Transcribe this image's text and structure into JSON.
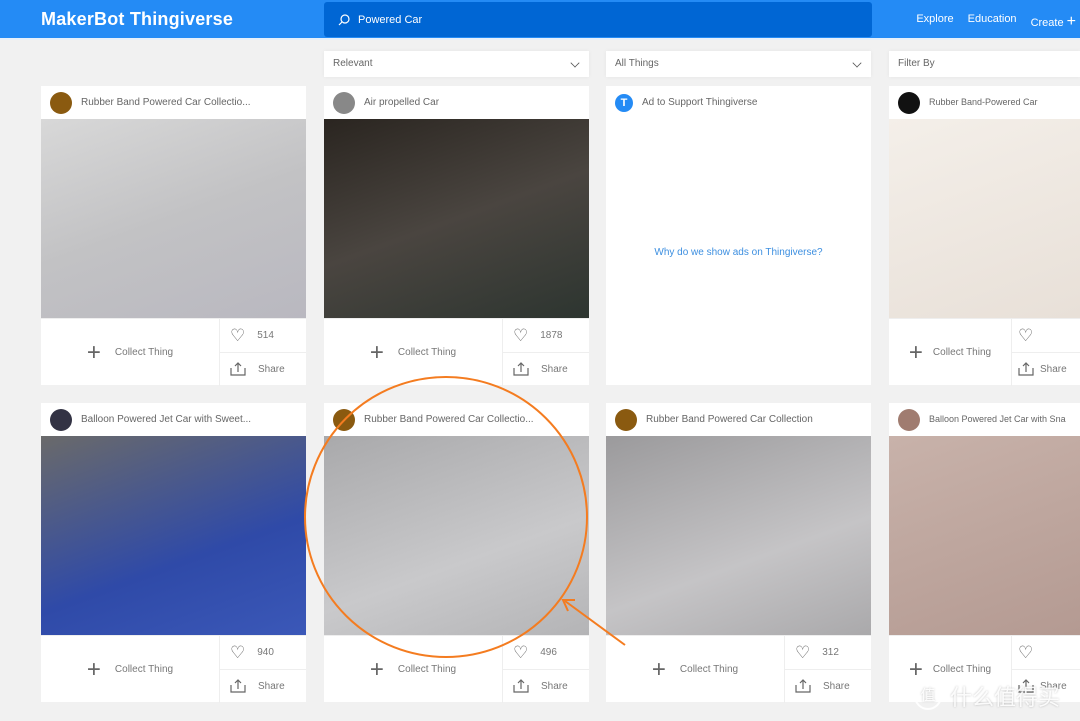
{
  "header": {
    "logo": "MakerBot Thingiverse",
    "search_value": "Powered Car",
    "nav": [
      "Explore",
      "Education",
      "Create"
    ]
  },
  "filters": {
    "sort": "Relevant",
    "type": "All Things",
    "filter": "Filter By"
  },
  "ad": {
    "title": "Ad to Support Thingiverse",
    "link": "Why do we show ads on Thingiverse?"
  },
  "collect_label": "Collect Thing",
  "share_label": "Share",
  "cards": [
    {
      "title": "Rubber Band Powered Car Collectio...",
      "likes": "514"
    },
    {
      "title": "Air propelled Car",
      "likes": "1878"
    },
    {
      "title": "Rubber Band-Powered Car",
      "likes": ""
    },
    {
      "title": "Balloon Powered Jet Car with Sweet...",
      "likes": "940"
    },
    {
      "title": "Rubber Band Powered Car Collectio...",
      "likes": "496"
    },
    {
      "title": "Rubber Band Powered Car Collection",
      "likes": "312"
    },
    {
      "title": "Balloon Powered Jet Car with Sna",
      "likes": ""
    }
  ],
  "annotation_color": "#f47c20",
  "watermark": "什么值得买"
}
